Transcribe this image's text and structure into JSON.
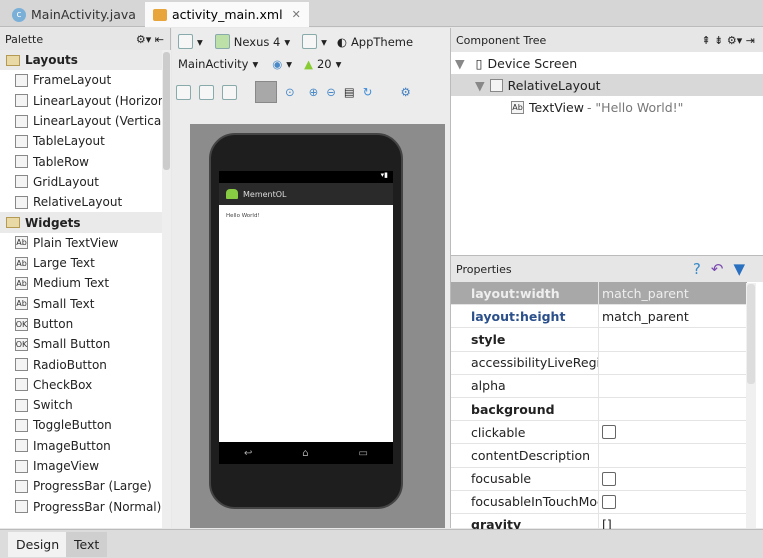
{
  "tabs": [
    {
      "label": "MainActivity.java",
      "icon": "class-icon"
    },
    {
      "label": "activity_main.xml",
      "icon": "xml-layout-icon",
      "active": true
    }
  ],
  "palette": {
    "title": "Palette",
    "groups": [
      {
        "label": "Layouts",
        "items": [
          "FrameLayout",
          "LinearLayout (Horizont",
          "LinearLayout (Vertical)",
          "TableLayout",
          "TableRow",
          "GridLayout",
          "RelativeLayout"
        ]
      },
      {
        "label": "Widgets",
        "items": [
          "Plain TextView",
          "Large Text",
          "Medium Text",
          "Small Text",
          "Button",
          "Small Button",
          "RadioButton",
          "CheckBox",
          "Switch",
          "ToggleButton",
          "ImageButton",
          "ImageView",
          "ProgressBar (Large)",
          "ProgressBar (Normal)"
        ]
      }
    ]
  },
  "toolbar": {
    "device": "Nexus 4",
    "theme": "AppTheme",
    "activity": "MainActivity",
    "api": "20"
  },
  "preview": {
    "app_name": "MementOL",
    "text": "Hello World!"
  },
  "tree": {
    "title": "Component Tree",
    "items": [
      {
        "label": "Device Screen"
      },
      {
        "label": "RelativeLayout"
      },
      {
        "label": "TextView",
        "detail": "- \"Hello World!\""
      }
    ]
  },
  "properties": {
    "title": "Properties",
    "rows": [
      {
        "name": "layout:width",
        "value": "match_parent",
        "selected": true
      },
      {
        "name": "layout:height",
        "value": "match_parent",
        "blue": true
      },
      {
        "name": "style",
        "value": "",
        "bold": true
      },
      {
        "name": "accessibilityLiveRegion",
        "value": ""
      },
      {
        "name": "alpha",
        "value": ""
      },
      {
        "name": "background",
        "value": "",
        "bold": true
      },
      {
        "name": "clickable",
        "checkbox": true
      },
      {
        "name": "contentDescription",
        "value": ""
      },
      {
        "name": "focusable",
        "checkbox": true
      },
      {
        "name": "focusableInTouchMoc",
        "checkbox": true
      },
      {
        "name": "gravity",
        "value": "[]",
        "bold": true
      }
    ]
  },
  "bottom_tabs": [
    "Design",
    "Text"
  ],
  "colors": {
    "accent": "#2a5fa0",
    "selected_row": "#a8a8a8"
  }
}
